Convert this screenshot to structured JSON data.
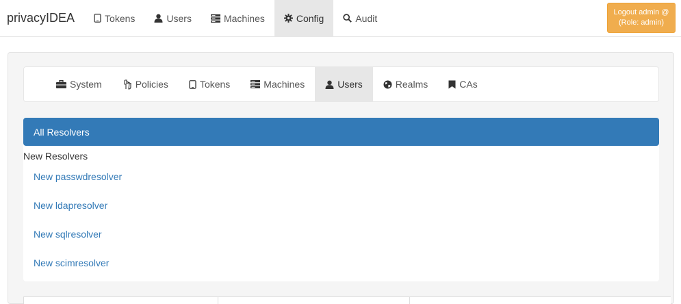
{
  "navbar": {
    "brand": "privacyIDEA",
    "items": [
      {
        "label": "Tokens",
        "icon": "phone-icon"
      },
      {
        "label": "Users",
        "icon": "user-icon"
      },
      {
        "label": "Machines",
        "icon": "server-icon"
      },
      {
        "label": "Config",
        "icon": "gear-icon",
        "active": true
      },
      {
        "label": "Audit",
        "icon": "search-icon"
      }
    ],
    "logout_line1": "Logout admin @",
    "logout_line2": "(Role: admin)"
  },
  "config_nav": {
    "items": [
      {
        "label": "System",
        "icon": "briefcase-icon"
      },
      {
        "label": "Policies",
        "icon": "hand-icon"
      },
      {
        "label": "Tokens",
        "icon": "phone-icon"
      },
      {
        "label": "Machines",
        "icon": "server-icon"
      },
      {
        "label": "Users",
        "icon": "user-icon",
        "active": true
      },
      {
        "label": "Realms",
        "icon": "globe-icon"
      },
      {
        "label": "CAs",
        "icon": "bookmark-icon"
      }
    ]
  },
  "resolvers": {
    "all_label": "All Resolvers",
    "new_heading": "New Resolvers",
    "links": [
      "New passwdresolver",
      "New ldapresolver",
      "New sqlresolver",
      "New scimresolver"
    ]
  },
  "colors": {
    "primary": "#337ab7",
    "warning": "#f0ad4e",
    "nav_active": "#e7e7e7"
  }
}
